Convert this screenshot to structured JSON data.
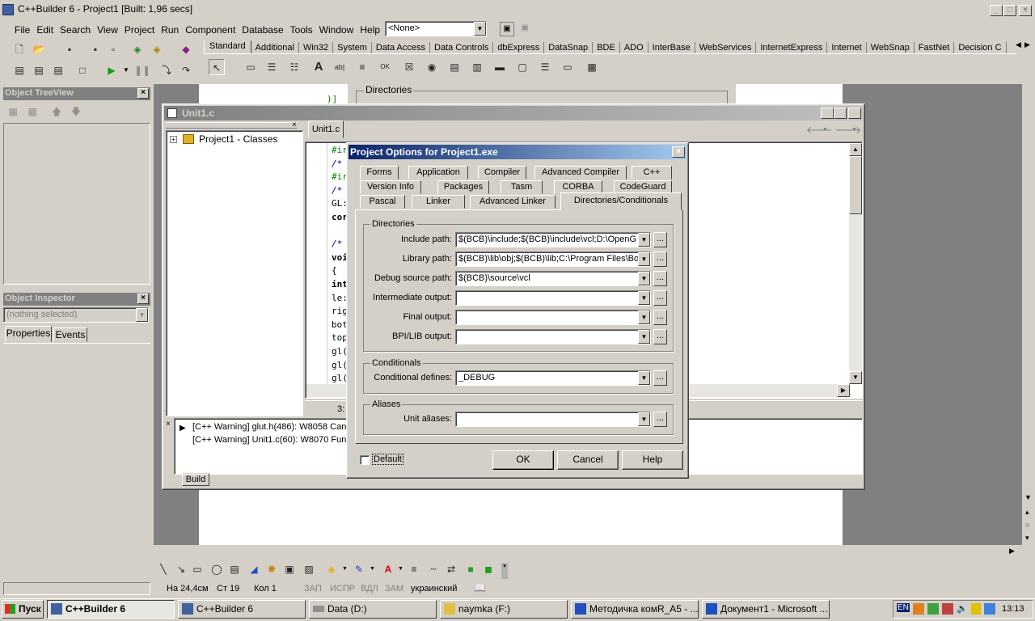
{
  "app": {
    "title": "C++Builder 6 - Project1 [Built: 1,96 secs]"
  },
  "menu": [
    {
      "label": "File"
    },
    {
      "label": "Edit"
    },
    {
      "label": "Search"
    },
    {
      "label": "View"
    },
    {
      "label": "Project"
    },
    {
      "label": "Run"
    },
    {
      "label": "Component"
    },
    {
      "label": "Database"
    },
    {
      "label": "Tools"
    },
    {
      "label": "Window"
    },
    {
      "label": "Help"
    }
  ],
  "desktop_combo": "<None>",
  "palette_tabs": [
    "Standard",
    "Additional",
    "Win32",
    "System",
    "Data Access",
    "Data Controls",
    "dbExpress",
    "DataSnap",
    "BDE",
    "ADO",
    "InterBase",
    "WebServices",
    "InternetExpress",
    "Internet",
    "WebSnap",
    "FastNet",
    "Decision C"
  ],
  "bg_dir_label": "Directories",
  "treeview": {
    "title": "Object TreeView"
  },
  "inspector": {
    "title": "Object Inspector",
    "selection": "(nothing selected)",
    "tabs": [
      "Properties",
      "Events"
    ]
  },
  "editor": {
    "title": "Unit1.c",
    "tab": "Unit1.c",
    "tree_root": "Project1 - Classes",
    "code_lines": [
      "#ir",
      "/*",
      "#ir",
      "/*",
      "GL:",
      "cor",
      "",
      "/*",
      "voi",
      "{",
      "int",
      "le:",
      "rig",
      "bot",
      "top",
      "gl(",
      "gl(",
      "gl("
    ],
    "status_line": "3:",
    "messages": [
      "[C++ Warning] glut.h(486): W8058 Cann",
      "[C++ Warning] Unit1.c(60): W8070 Func"
    ],
    "msg_tab": "Build"
  },
  "dialog": {
    "title": "Project Options for Project1.exe",
    "tabs_row1": [
      "Forms",
      "Application",
      "Compiler",
      "Advanced Compiler",
      "C++"
    ],
    "tabs_row2": [
      "Version Info",
      "Packages",
      "Tasm",
      "CORBA",
      "CodeGuard"
    ],
    "tabs_row3": [
      "Pascal",
      "Linker",
      "Advanced Linker",
      "Directories/Conditionals"
    ],
    "directories_group": "Directories",
    "fields": [
      {
        "label": "Include path:",
        "value": "$(BCB)\\include;$(BCB)\\include\\vcl;D:\\OpenG"
      },
      {
        "label": "Library path:",
        "value": "$(BCB)\\lib\\obj;$(BCB)\\lib;C:\\Program Files\\Bor"
      },
      {
        "label": "Debug source path:",
        "value": "$(BCB)\\source\\vcl"
      },
      {
        "label": "Intermediate output:",
        "value": ""
      },
      {
        "label": "Final output:",
        "value": ""
      },
      {
        "label": "BPI/LIB output:",
        "value": ""
      }
    ],
    "conditionals_group": "Conditionals",
    "conditional_label": "Conditional defines:",
    "conditional_value": "_DEBUG",
    "aliases_group": "Aliases",
    "alias_label": "Unit aliases:",
    "alias_value": "",
    "ellipsis": "...",
    "default_label": "Default",
    "ok": "OK",
    "cancel": "Cancel",
    "help": "Help"
  },
  "word_status": {
    "position": "На 24,4см",
    "line": "Ст 19",
    "col": "Кол 1",
    "rec": "ЗАП",
    "trk": "ИСПР",
    "ext": "ВДЛ",
    "ovr": "ЗАМ",
    "lang": "украинский"
  },
  "taskbar": {
    "start": "Пуск",
    "buttons": [
      "C++Builder 6",
      "C++Builder 6",
      "Data (D:)",
      "naymka (F:)",
      "Методичка комR_A5 - ...",
      "Документ1 - Microsoft ..."
    ],
    "lang": "EN",
    "clock": "13:13"
  }
}
